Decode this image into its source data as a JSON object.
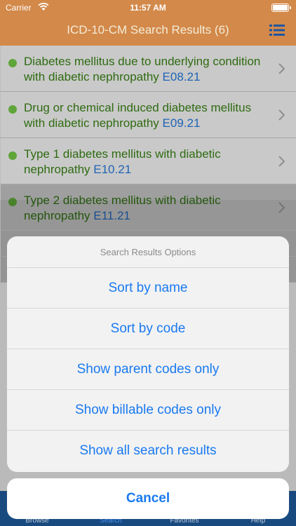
{
  "status_bar": {
    "carrier": "Carrier",
    "time": "11:57 AM"
  },
  "nav": {
    "title": "ICD-10-CM Search Results (6)"
  },
  "results": [
    {
      "label": "Diabetes mellitus due to underlying condition with diabetic nephropathy",
      "code": "E08.21"
    },
    {
      "label": "Drug or chemical induced diabetes mellitus with diabetic nephropathy",
      "code": "E09.21"
    },
    {
      "label": "Type 1 diabetes mellitus with diabetic nephropathy",
      "code": "E10.21"
    },
    {
      "label": "Type 2 diabetes mellitus with diabetic nephropathy",
      "code": "E11.21"
    }
  ],
  "action_sheet": {
    "title": "Search Results Options",
    "options": [
      "Sort by name",
      "Sort by code",
      "Show parent codes only",
      "Show billable codes only",
      "Show all search results"
    ],
    "cancel": "Cancel"
  },
  "tabbar": {
    "tabs": [
      "Browse",
      "Search",
      "Favorites",
      "Help"
    ]
  },
  "colors": {
    "nav_bg": "#d3894a",
    "tab_bg": "#1b4f86",
    "accent_blue": "#1a7af0",
    "result_text": "#2f6b12",
    "code_text": "#1e63b5",
    "dot_green": "#5fa53a"
  }
}
